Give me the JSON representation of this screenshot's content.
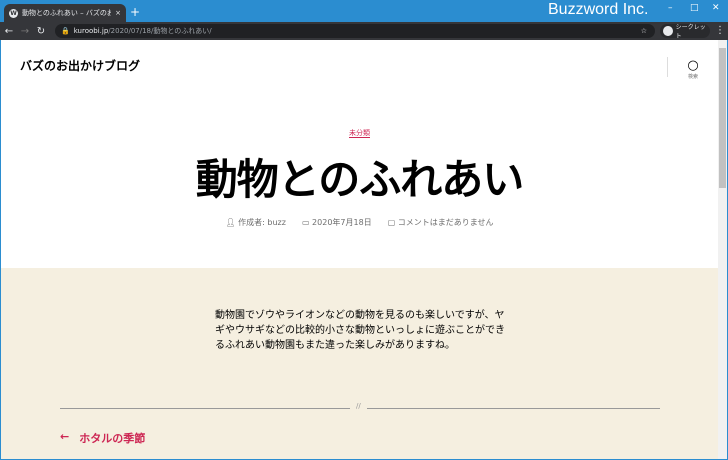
{
  "browser": {
    "tab_title": "動物とのふれあい – バズのお出かけブ",
    "tab_close": "×",
    "new_tab": "+",
    "brand": "Buzzword Inc.",
    "url_domain": "kuroobi.jp",
    "url_path": "/2020/07/18/動物とのふれあい/",
    "incognito_label": "シークレット"
  },
  "site": {
    "title": "バズのお出かけブログ",
    "search_label": "検索"
  },
  "post": {
    "category": "未分類",
    "title": "動物とのふれあい",
    "author": "作成者: buzz",
    "date": "2020年7月18日",
    "comments": "コメントはまだありません",
    "body": "動物園でゾウやライオンなどの動物を見るのも楽しいですが、ヤギやウサギなどの比較的小さな動物といっしょに遊ぶことができるふれあい動物園もまた違った楽しみがありますね。",
    "divider": "//",
    "prev_arrow": "←",
    "prev_title": "ホタルの季節"
  }
}
